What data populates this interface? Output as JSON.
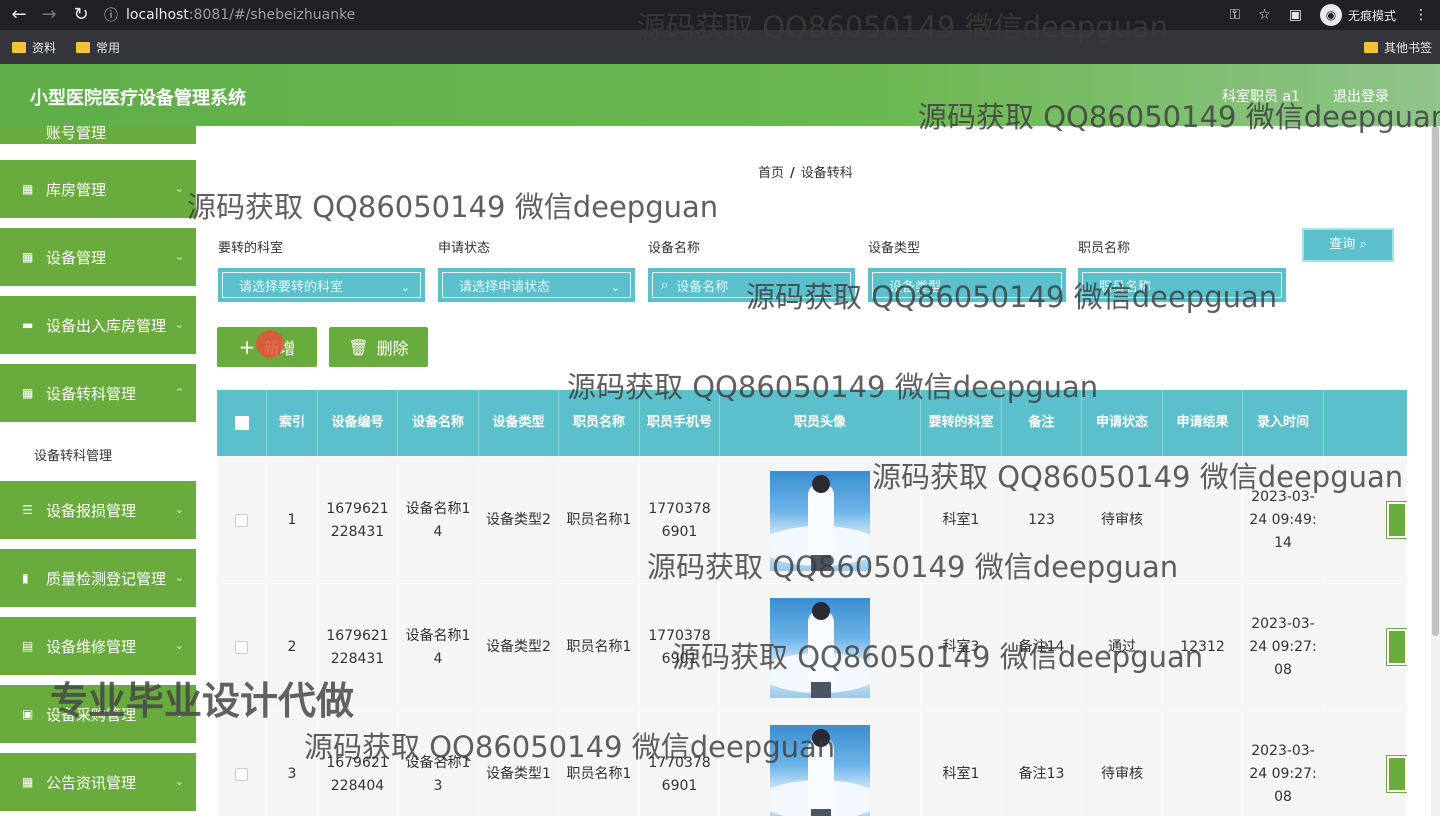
{
  "browser": {
    "url_host": "localhost",
    "url_rest": ":8081/#/shebeizhuanke",
    "incognito_label": "无痕模式",
    "bookmarks": [
      "资料",
      "常用"
    ],
    "other_bookmarks": "其他书签"
  },
  "header": {
    "title": "小型医院医疗设备管理系统",
    "user": "科室职员 a1",
    "logout": "退出登录"
  },
  "sidebar": {
    "partial_top": "账号管理",
    "items": [
      {
        "label": "库房管理",
        "icon": "grid-icon"
      },
      {
        "label": "设备管理",
        "icon": "grid-icon"
      },
      {
        "label": "设备出入库房管理",
        "icon": "briefcase-icon"
      },
      {
        "label": "设备转科管理",
        "icon": "grid-icon"
      },
      {
        "label": "设备报损管理",
        "icon": "sliders-icon"
      },
      {
        "label": "质量检测登记管理",
        "icon": "bar-chart-icon"
      },
      {
        "label": "设备维修管理",
        "icon": "book-icon"
      },
      {
        "label": "设备采购管理",
        "icon": "clipboard-icon"
      },
      {
        "label": "公告资讯管理",
        "icon": "grid-icon"
      }
    ],
    "sub_item": "设备转科管理"
  },
  "breadcrumb": {
    "home": "首页",
    "sep": "/",
    "current": "设备转科"
  },
  "filters": [
    {
      "label": "要转的科室",
      "placeholder": "请选择要转的科室"
    },
    {
      "label": "申请状态",
      "placeholder": "请选择申请状态"
    },
    {
      "label": "设备名称",
      "placeholder": "设备名称"
    },
    {
      "label": "设备类型",
      "placeholder": "设备类型"
    },
    {
      "label": "职员名称",
      "placeholder": "职员名称"
    }
  ],
  "search_button": "查询",
  "actions": {
    "add": "新增",
    "delete": "删除"
  },
  "table": {
    "columns": [
      "索引",
      "设备编号",
      "设备名称",
      "设备类型",
      "职员名称",
      "职员手机号",
      "职员头像",
      "要转的科室",
      "备注",
      "申请状态",
      "申请结果",
      "录入时间"
    ],
    "rows": [
      {
        "index": "1",
        "code": "1679621228431",
        "name": "设备名称14",
        "type": "设备类型2",
        "staff": "职员名称1",
        "phone": "17703786901",
        "dept": "科室1",
        "note": "123",
        "status": "待审核",
        "result": "",
        "time": "2023-03-24 09:49:14"
      },
      {
        "index": "2",
        "code": "1679621228431",
        "name": "设备名称14",
        "type": "设备类型2",
        "staff": "职员名称1",
        "phone": "17703786901",
        "dept": "科室3",
        "note": "备注14",
        "status": "通过",
        "result": "12312",
        "time": "2023-03-24 09:27:08"
      },
      {
        "index": "3",
        "code": "1679621228404",
        "name": "设备名称13",
        "type": "设备类型1",
        "staff": "职员名称1",
        "phone": "17703786901",
        "dept": "科室1",
        "note": "备注13",
        "status": "待审核",
        "result": "",
        "time": "2023-03-24 09:27:08"
      }
    ]
  },
  "watermark": "源码获取 QQ86050149 微信deepguan",
  "watermark_big": "专业毕业设计代做"
}
